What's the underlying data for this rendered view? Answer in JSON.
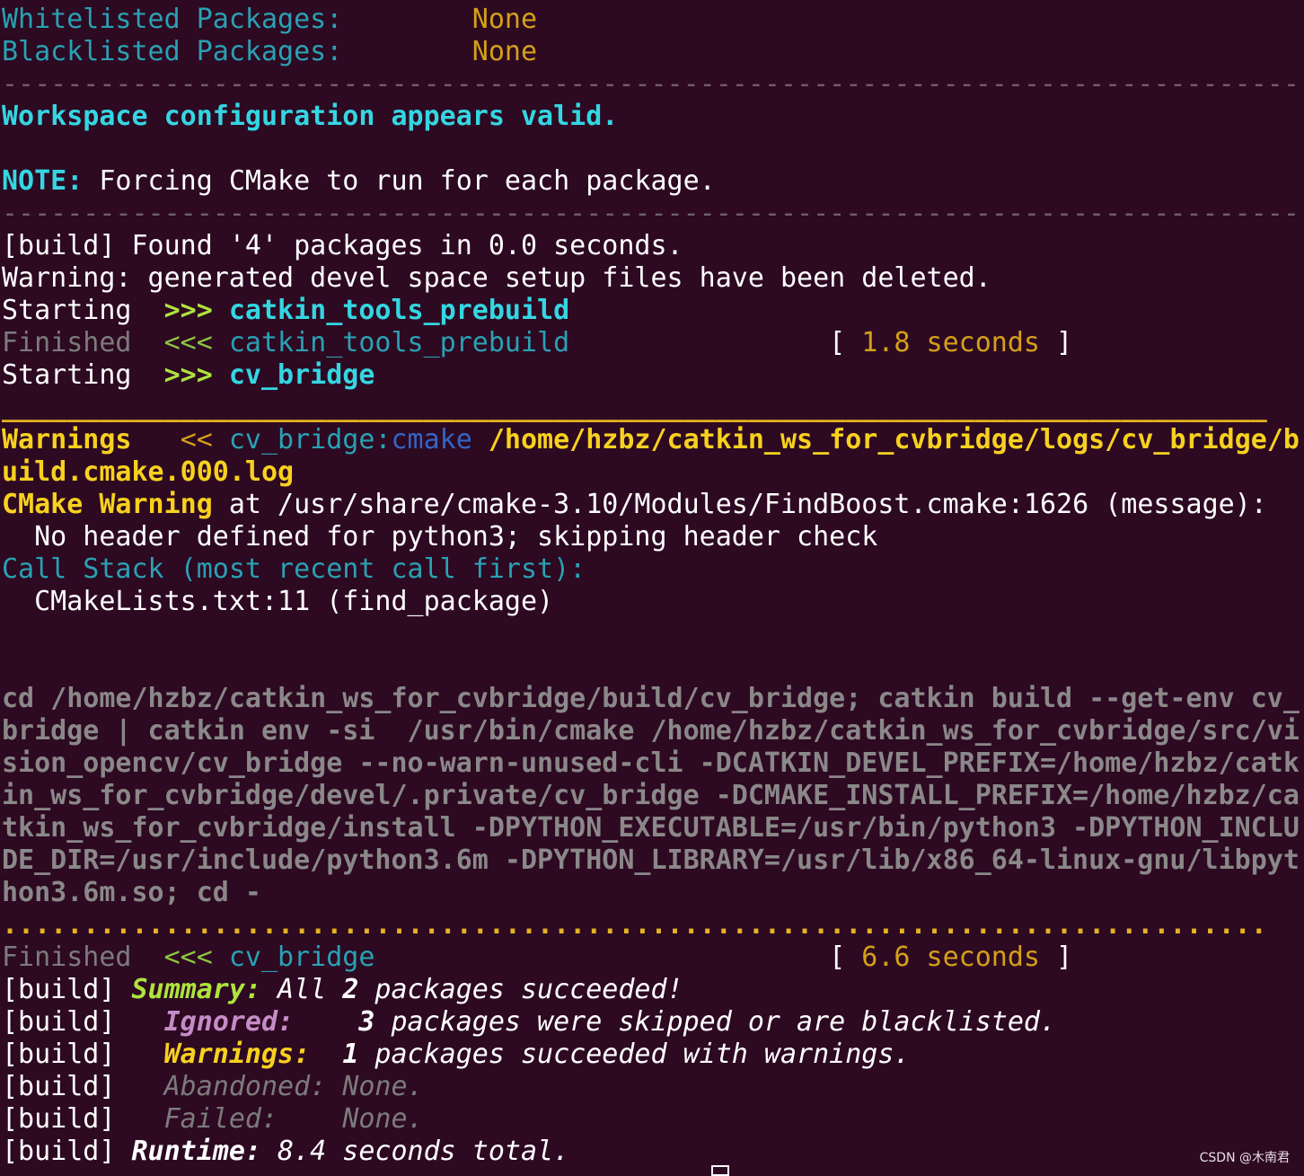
{
  "whitelisted_label": "Whitelisted Packages:",
  "whitelisted_value": "None",
  "blacklisted_label": "Blacklisted Packages:",
  "blacklisted_value": "None",
  "separator": "------------------------------------------------------------------------------------------------------------------------",
  "workspace_valid": "Workspace configuration appears valid.",
  "note_label": "NOTE:",
  "note_text": " Forcing CMake to run for each package.",
  "found_packages": "[build] Found '4' packages in 0.0 seconds.",
  "warning_deleted": "Warning: generated devel space setup files have been deleted.",
  "starting_label": "Starting",
  "start_arrow": ">>>",
  "finish_arrow": "<<<",
  "finished_label": "Finished",
  "pkg_prebuild": "catkin_tools_prebuild",
  "pkg_cv_bridge": "cv_bridge",
  "time_prebuild": "1.8 seconds",
  "time_cv_bridge": "6.6 seconds",
  "bracket_open": "[",
  "bracket_close": "]",
  "underline_sep": "______________________________________________________________________________",
  "warnings_label": "Warnings",
  "warnings_arrow": "<<",
  "warnings_stage": "cmake",
  "warnings_log_1": "/home/hzbz/catkin_ws_for_cvbridge/logs/cv_bridge/b",
  "warnings_log_2": "uild.cmake.000.log",
  "cmake_warning_label": "CMake Warning",
  "cmake_warning_text": " at /usr/share/cmake-3.10/Modules/FindBoost.cmake:1626 (message):",
  "no_header": "  No header defined for python3; skipping header check",
  "call_stack": "Call Stack (most recent call first):",
  "cmakelists": "  CMakeLists.txt:11 (find_package)",
  "cmd_lines": [
    "cd /home/hzbz/catkin_ws_for_cvbridge/build/cv_bridge; catkin build --get-env cv_",
    "bridge | catkin env -si  /usr/bin/cmake /home/hzbz/catkin_ws_for_cvbridge/src/vi",
    "sion_opencv/cv_bridge --no-warn-unused-cli -DCATKIN_DEVEL_PREFIX=/home/hzbz/catk",
    "in_ws_for_cvbridge/devel/.private/cv_bridge -DCMAKE_INSTALL_PREFIX=/home/hzbz/ca",
    "tkin_ws_for_cvbridge/install -DPYTHON_EXECUTABLE=/usr/bin/python3 -DPYTHON_INCLU",
    "DE_DIR=/usr/include/python3.6m -DPYTHON_LIBRARY=/usr/lib/x86_64-linux-gnu/libpyt",
    "hon3.6m.so; cd -"
  ],
  "dot_sep": "..............................................................................",
  "build_prefix": "[build]",
  "summary_label": "Summary:",
  "summary_all": " All ",
  "summary_count": "2",
  "summary_text": " packages succeeded!",
  "ignored_label": "Ignored:",
  "ignored_count": "3",
  "ignored_text": " packages were skipped or are blacklisted.",
  "warnings2_label": "Warnings:",
  "warnings2_count": "1",
  "warnings2_text": " packages succeeded with warnings.",
  "abandoned_label": "Abandoned:",
  "abandoned_value": "None.",
  "failed_label": "Failed:",
  "failed_value": "None.",
  "runtime_label": "Runtime:",
  "runtime_text": " 8.4 seconds total.",
  "watermark": "CSDN @木南君"
}
